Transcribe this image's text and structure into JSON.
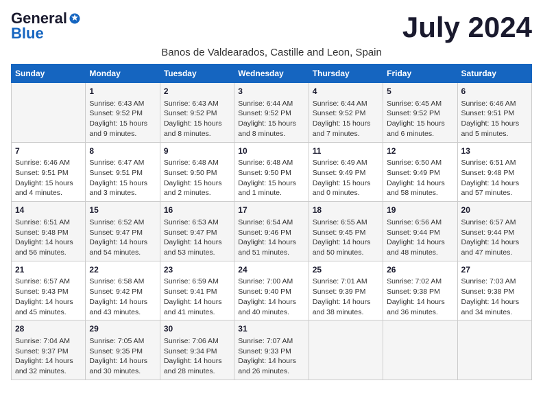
{
  "logo": {
    "general": "General",
    "blue": "Blue"
  },
  "title": "July 2024",
  "subtitle": "Banos de Valdearados, Castille and Leon, Spain",
  "days_of_week": [
    "Sunday",
    "Monday",
    "Tuesday",
    "Wednesday",
    "Thursday",
    "Friday",
    "Saturday"
  ],
  "weeks": [
    [
      {
        "day": "",
        "sunrise": "",
        "sunset": "",
        "daylight": ""
      },
      {
        "day": "1",
        "sunrise": "Sunrise: 6:43 AM",
        "sunset": "Sunset: 9:52 PM",
        "daylight": "Daylight: 15 hours and 9 minutes."
      },
      {
        "day": "2",
        "sunrise": "Sunrise: 6:43 AM",
        "sunset": "Sunset: 9:52 PM",
        "daylight": "Daylight: 15 hours and 8 minutes."
      },
      {
        "day": "3",
        "sunrise": "Sunrise: 6:44 AM",
        "sunset": "Sunset: 9:52 PM",
        "daylight": "Daylight: 15 hours and 8 minutes."
      },
      {
        "day": "4",
        "sunrise": "Sunrise: 6:44 AM",
        "sunset": "Sunset: 9:52 PM",
        "daylight": "Daylight: 15 hours and 7 minutes."
      },
      {
        "day": "5",
        "sunrise": "Sunrise: 6:45 AM",
        "sunset": "Sunset: 9:52 PM",
        "daylight": "Daylight: 15 hours and 6 minutes."
      },
      {
        "day": "6",
        "sunrise": "Sunrise: 6:46 AM",
        "sunset": "Sunset: 9:51 PM",
        "daylight": "Daylight: 15 hours and 5 minutes."
      }
    ],
    [
      {
        "day": "7",
        "sunrise": "Sunrise: 6:46 AM",
        "sunset": "Sunset: 9:51 PM",
        "daylight": "Daylight: 15 hours and 4 minutes."
      },
      {
        "day": "8",
        "sunrise": "Sunrise: 6:47 AM",
        "sunset": "Sunset: 9:51 PM",
        "daylight": "Daylight: 15 hours and 3 minutes."
      },
      {
        "day": "9",
        "sunrise": "Sunrise: 6:48 AM",
        "sunset": "Sunset: 9:50 PM",
        "daylight": "Daylight: 15 hours and 2 minutes."
      },
      {
        "day": "10",
        "sunrise": "Sunrise: 6:48 AM",
        "sunset": "Sunset: 9:50 PM",
        "daylight": "Daylight: 15 hours and 1 minute."
      },
      {
        "day": "11",
        "sunrise": "Sunrise: 6:49 AM",
        "sunset": "Sunset: 9:49 PM",
        "daylight": "Daylight: 15 hours and 0 minutes."
      },
      {
        "day": "12",
        "sunrise": "Sunrise: 6:50 AM",
        "sunset": "Sunset: 9:49 PM",
        "daylight": "Daylight: 14 hours and 58 minutes."
      },
      {
        "day": "13",
        "sunrise": "Sunrise: 6:51 AM",
        "sunset": "Sunset: 9:48 PM",
        "daylight": "Daylight: 14 hours and 57 minutes."
      }
    ],
    [
      {
        "day": "14",
        "sunrise": "Sunrise: 6:51 AM",
        "sunset": "Sunset: 9:48 PM",
        "daylight": "Daylight: 14 hours and 56 minutes."
      },
      {
        "day": "15",
        "sunrise": "Sunrise: 6:52 AM",
        "sunset": "Sunset: 9:47 PM",
        "daylight": "Daylight: 14 hours and 54 minutes."
      },
      {
        "day": "16",
        "sunrise": "Sunrise: 6:53 AM",
        "sunset": "Sunset: 9:47 PM",
        "daylight": "Daylight: 14 hours and 53 minutes."
      },
      {
        "day": "17",
        "sunrise": "Sunrise: 6:54 AM",
        "sunset": "Sunset: 9:46 PM",
        "daylight": "Daylight: 14 hours and 51 minutes."
      },
      {
        "day": "18",
        "sunrise": "Sunrise: 6:55 AM",
        "sunset": "Sunset: 9:45 PM",
        "daylight": "Daylight: 14 hours and 50 minutes."
      },
      {
        "day": "19",
        "sunrise": "Sunrise: 6:56 AM",
        "sunset": "Sunset: 9:44 PM",
        "daylight": "Daylight: 14 hours and 48 minutes."
      },
      {
        "day": "20",
        "sunrise": "Sunrise: 6:57 AM",
        "sunset": "Sunset: 9:44 PM",
        "daylight": "Daylight: 14 hours and 47 minutes."
      }
    ],
    [
      {
        "day": "21",
        "sunrise": "Sunrise: 6:57 AM",
        "sunset": "Sunset: 9:43 PM",
        "daylight": "Daylight: 14 hours and 45 minutes."
      },
      {
        "day": "22",
        "sunrise": "Sunrise: 6:58 AM",
        "sunset": "Sunset: 9:42 PM",
        "daylight": "Daylight: 14 hours and 43 minutes."
      },
      {
        "day": "23",
        "sunrise": "Sunrise: 6:59 AM",
        "sunset": "Sunset: 9:41 PM",
        "daylight": "Daylight: 14 hours and 41 minutes."
      },
      {
        "day": "24",
        "sunrise": "Sunrise: 7:00 AM",
        "sunset": "Sunset: 9:40 PM",
        "daylight": "Daylight: 14 hours and 40 minutes."
      },
      {
        "day": "25",
        "sunrise": "Sunrise: 7:01 AM",
        "sunset": "Sunset: 9:39 PM",
        "daylight": "Daylight: 14 hours and 38 minutes."
      },
      {
        "day": "26",
        "sunrise": "Sunrise: 7:02 AM",
        "sunset": "Sunset: 9:38 PM",
        "daylight": "Daylight: 14 hours and 36 minutes."
      },
      {
        "day": "27",
        "sunrise": "Sunrise: 7:03 AM",
        "sunset": "Sunset: 9:38 PM",
        "daylight": "Daylight: 14 hours and 34 minutes."
      }
    ],
    [
      {
        "day": "28",
        "sunrise": "Sunrise: 7:04 AM",
        "sunset": "Sunset: 9:37 PM",
        "daylight": "Daylight: 14 hours and 32 minutes."
      },
      {
        "day": "29",
        "sunrise": "Sunrise: 7:05 AM",
        "sunset": "Sunset: 9:35 PM",
        "daylight": "Daylight: 14 hours and 30 minutes."
      },
      {
        "day": "30",
        "sunrise": "Sunrise: 7:06 AM",
        "sunset": "Sunset: 9:34 PM",
        "daylight": "Daylight: 14 hours and 28 minutes."
      },
      {
        "day": "31",
        "sunrise": "Sunrise: 7:07 AM",
        "sunset": "Sunset: 9:33 PM",
        "daylight": "Daylight: 14 hours and 26 minutes."
      },
      {
        "day": "",
        "sunrise": "",
        "sunset": "",
        "daylight": ""
      },
      {
        "day": "",
        "sunrise": "",
        "sunset": "",
        "daylight": ""
      },
      {
        "day": "",
        "sunrise": "",
        "sunset": "",
        "daylight": ""
      }
    ]
  ]
}
